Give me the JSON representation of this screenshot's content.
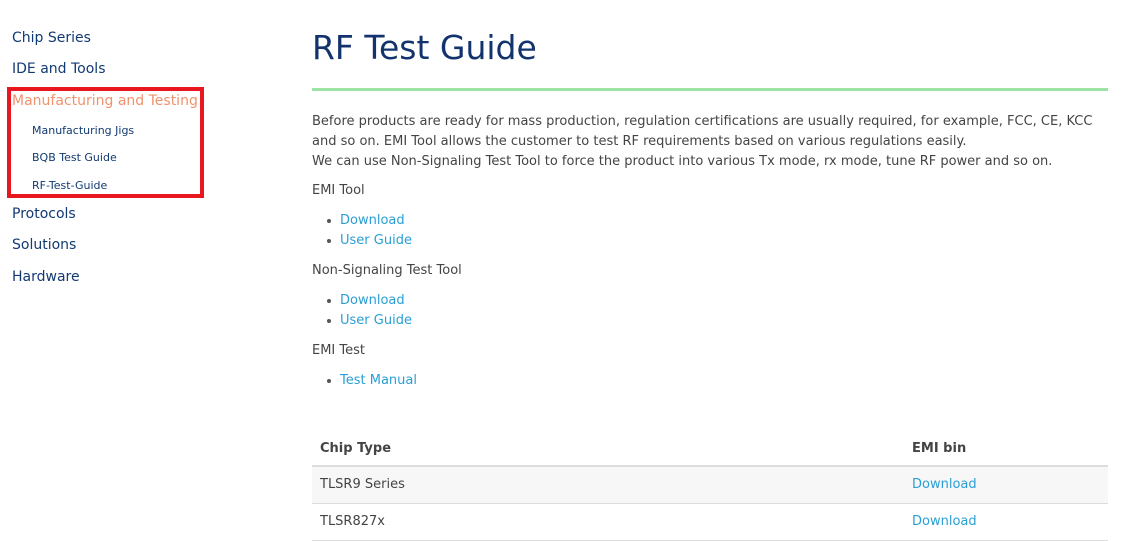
{
  "sidebar": {
    "items": [
      {
        "label": "Chip Series"
      },
      {
        "label": "IDE and Tools"
      },
      {
        "label": "Manufacturing and Testing",
        "active": true,
        "children": [
          {
            "label": "Manufacturing Jigs"
          },
          {
            "label": "BQB Test Guide"
          },
          {
            "label": "RF-Test-Guide"
          }
        ]
      },
      {
        "label": "Protocols"
      },
      {
        "label": "Solutions"
      },
      {
        "label": "Hardware"
      }
    ]
  },
  "colors": {
    "nav_text": "#123a72",
    "nav_active": "#f0926c",
    "highlight_border": "#e8161f",
    "title": "#12336e",
    "title_rule": "#9de3a4",
    "link": "#2a9fd6",
    "body_text": "#444444"
  },
  "main": {
    "title": "RF Test Guide",
    "intro_line1": "Before products are ready for mass production, regulation certifications are usually required, for example, FCC, CE, KCC and so on. EMI Tool allows the customer to test RF requirements based on various regulations easily.",
    "intro_line2": "We can use Non-Signaling Test Tool to force the product into various Tx mode, rx mode, tune RF power and so on.",
    "sections": [
      {
        "label": "EMI Tool",
        "links": [
          "Download",
          "User Guide"
        ]
      },
      {
        "label": "Non-Signaling Test Tool",
        "links": [
          "Download",
          "User Guide"
        ]
      },
      {
        "label": "EMI Test",
        "links": [
          "Test Manual"
        ]
      }
    ],
    "table": {
      "headers": [
        "Chip Type",
        "EMI bin"
      ],
      "rows": [
        [
          "TLSR9 Series",
          "Download"
        ],
        [
          "TLSR827x",
          "Download"
        ]
      ]
    }
  }
}
